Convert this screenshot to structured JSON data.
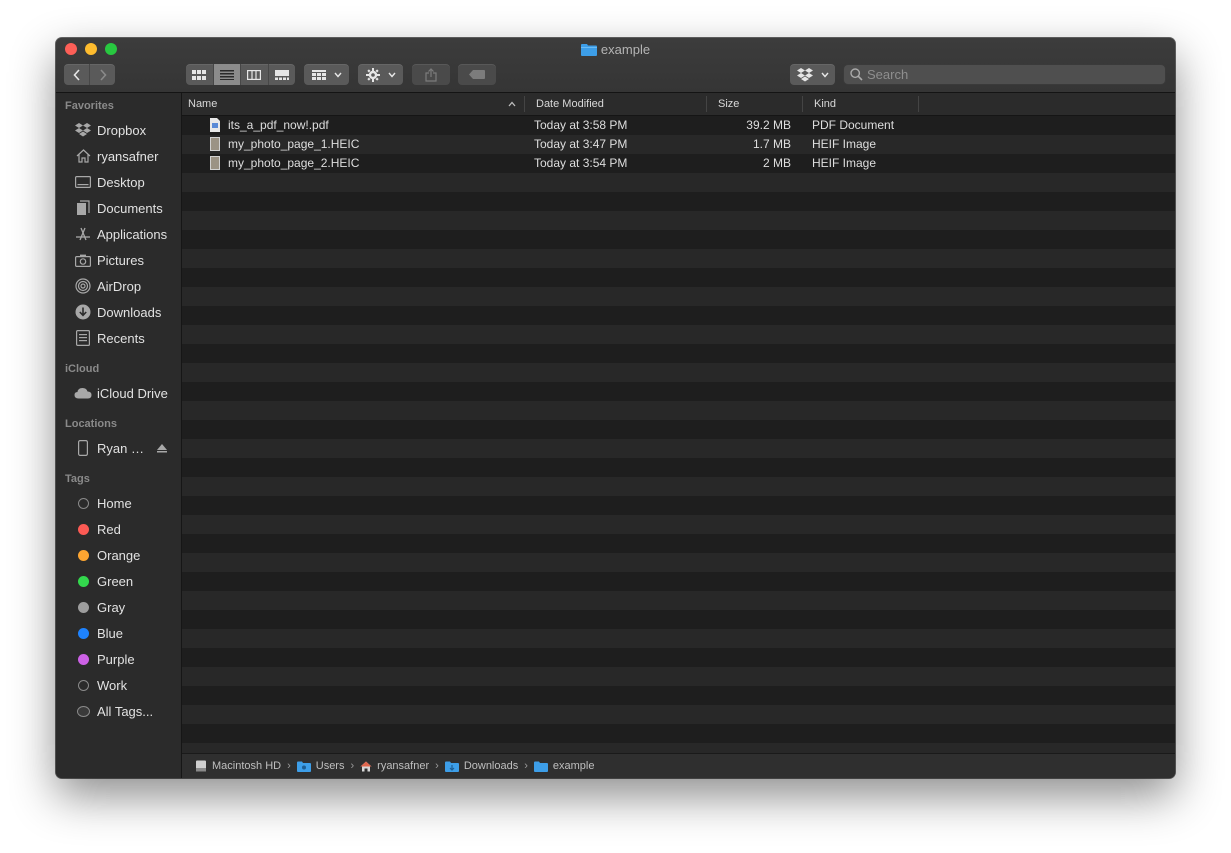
{
  "window": {
    "title": "example"
  },
  "toolbar": {
    "back_label": "‹",
    "forward_label": "›",
    "search_placeholder": "Search"
  },
  "sidebar": {
    "favorites_header": "Favorites",
    "favorites": [
      {
        "label": "Dropbox",
        "icon": "dropbox-icon"
      },
      {
        "label": "ryansafner",
        "icon": "home-icon"
      },
      {
        "label": "Desktop",
        "icon": "desktop-icon"
      },
      {
        "label": "Documents",
        "icon": "documents-icon"
      },
      {
        "label": "Applications",
        "icon": "applications-icon"
      },
      {
        "label": "Pictures",
        "icon": "camera-icon"
      },
      {
        "label": "AirDrop",
        "icon": "airdrop-icon"
      },
      {
        "label": "Downloads",
        "icon": "downloads-icon"
      },
      {
        "label": "Recents",
        "icon": "recents-icon"
      }
    ],
    "icloud_header": "iCloud",
    "icloud": [
      {
        "label": "iCloud Drive",
        "icon": "cloud-icon"
      }
    ],
    "locations_header": "Locations",
    "locations": [
      {
        "label": "Ryan S...",
        "icon": "iphone-icon"
      }
    ],
    "tags_header": "Tags",
    "tags": [
      {
        "label": "Home",
        "color": ""
      },
      {
        "label": "Red",
        "color": "#fc5a54"
      },
      {
        "label": "Orange",
        "color": "#fda531"
      },
      {
        "label": "Green",
        "color": "#33d84d"
      },
      {
        "label": "Gray",
        "color": "#9d9d9d"
      },
      {
        "label": "Blue",
        "color": "#1e83ff"
      },
      {
        "label": "Purple",
        "color": "#cd61e6"
      },
      {
        "label": "Work",
        "color": ""
      },
      {
        "label": "All Tags...",
        "color": ""
      }
    ]
  },
  "columns": {
    "name": "Name",
    "date": "Date Modified",
    "size": "Size",
    "kind": "Kind"
  },
  "files": [
    {
      "name": "its_a_pdf_now!.pdf",
      "date": "Today at 3:58 PM",
      "size": "39.2 MB",
      "kind": "PDF Document",
      "icon": "pdf-file-icon"
    },
    {
      "name": "my_photo_page_1.HEIC",
      "date": "Today at 3:47 PM",
      "size": "1.7 MB",
      "kind": "HEIF Image",
      "icon": "image-file-icon"
    },
    {
      "name": "my_photo_page_2.HEIC",
      "date": "Today at 3:54 PM",
      "size": "2 MB",
      "kind": "HEIF Image",
      "icon": "image-file-icon"
    }
  ],
  "pathbar": [
    {
      "label": "Macintosh HD",
      "icon": "hard-drive-icon"
    },
    {
      "label": "Users",
      "icon": "folder-icon"
    },
    {
      "label": "ryansafner",
      "icon": "home-icon"
    },
    {
      "label": "Downloads",
      "icon": "folder-icon"
    },
    {
      "label": "example",
      "icon": "folder-icon"
    }
  ],
  "colors": {
    "accent_folder": "#3d9ee8"
  }
}
